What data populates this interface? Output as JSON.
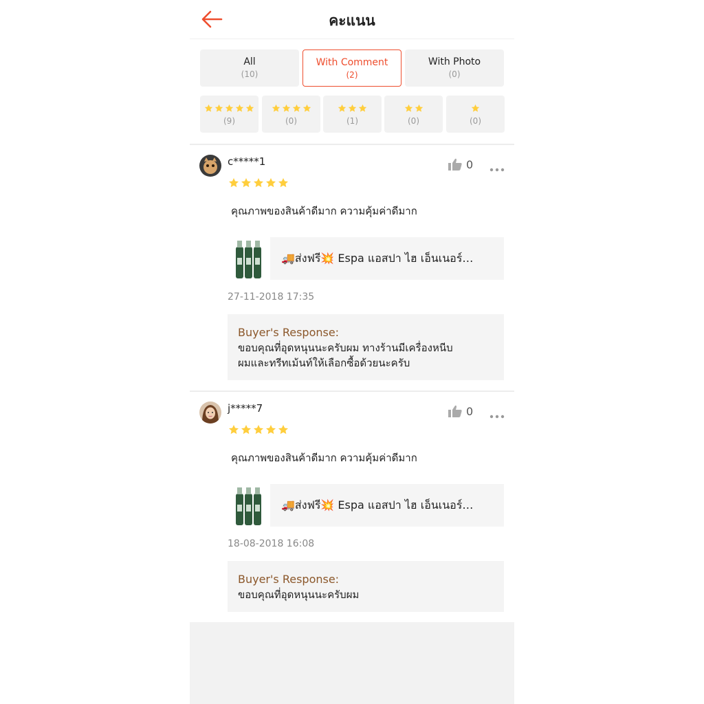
{
  "header": {
    "title": "คะแนน"
  },
  "filter_tabs": [
    {
      "label": "All",
      "count": "(10)"
    },
    {
      "label": "With Comment",
      "count": "(2)"
    },
    {
      "label": "With Photo",
      "count": "(0)"
    }
  ],
  "active_filter": "With Comment",
  "star_tabs": [
    {
      "stars": 5,
      "count": "(9)"
    },
    {
      "stars": 4,
      "count": "(0)"
    },
    {
      "stars": 3,
      "count": "(1)"
    },
    {
      "stars": 2,
      "count": "(0)"
    },
    {
      "stars": 1,
      "count": "(0)"
    }
  ],
  "reviews": [
    {
      "username": "c*****1",
      "likes": "0",
      "rating": 5,
      "comment": "คุณภาพของสินค้าดีมาก ความคุ้มค่าดีมาก",
      "product_title": "🚚ส่งฟรี💥 Espa แอสปา ไฮ เอ็นเนอร์…",
      "date": "27-11-2018 17:35",
      "response_label": "Buyer's Response:",
      "response_text": "ขอบคุณที่อุดหนุนนะครับผม ทางร้านมีเครื่องหนีบ\nผมและทรีทเม้นท์ให้เลือกซื้อด้วยนะครับ"
    },
    {
      "username": "j*****7",
      "likes": "0",
      "rating": 5,
      "comment": "คุณภาพของสินค้าดีมาก ความคุ้มค่าดีมาก",
      "product_title": "🚚ส่งฟรี💥 Espa แอสปา ไฮ เอ็นเนอร์…",
      "date": "18-08-2018 16:08",
      "response_label": "Buyer's Response:",
      "response_text": "ขอบคุณที่อุดหนุนนะครับผม"
    }
  ],
  "colors": {
    "accent": "#ee4d2d",
    "star": "#ffce3d",
    "response_label": "#8b572a",
    "panel_bg": "#f2f2f2"
  },
  "icons": {
    "back": "arrow-left-icon",
    "like": "thumbs-up-icon",
    "more": "more-dots-icon",
    "star": "star-icon"
  }
}
